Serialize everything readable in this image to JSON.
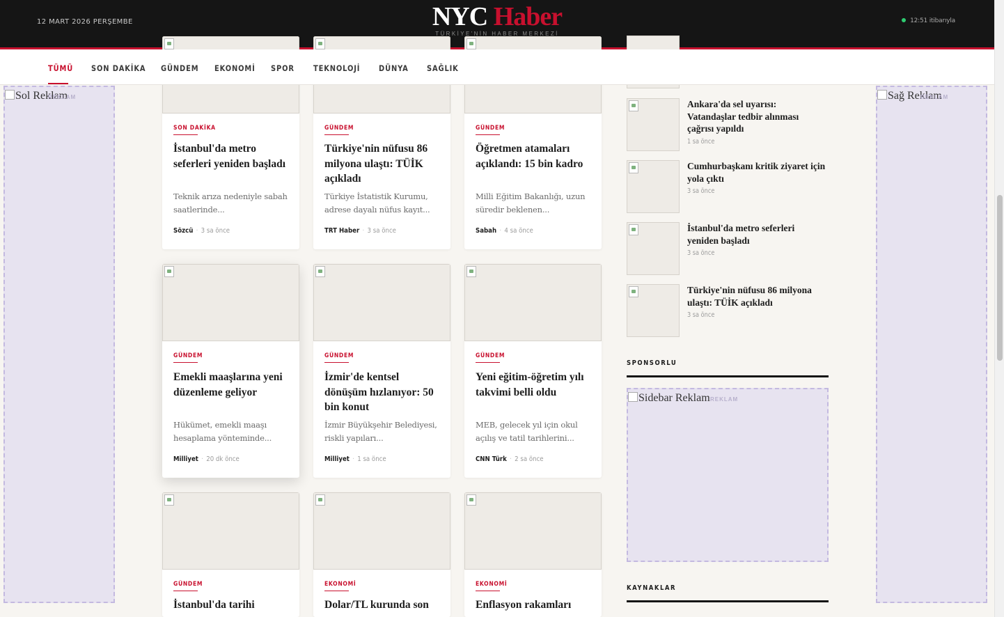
{
  "header": {
    "date": "12 MART 2026 PERŞEMBE",
    "logo_nyc": "NYC",
    "logo_haber": "Haber",
    "tagline": "TÜRKİYE'NİN HABER MERKEZİ",
    "live_time": "12:51 itibarıyla"
  },
  "nav": {
    "items": [
      "TÜMÜ",
      "SON DAKİKA",
      "GÜNDEM",
      "EKONOMİ",
      "SPOR",
      "TEKNOLOJİ",
      "DÜNYA",
      "SAĞLIK"
    ],
    "active": "TÜMÜ"
  },
  "ads": {
    "left_label": "Sol Reklam",
    "right_label": "Sağ Reklam",
    "sidebar_label": "Sidebar Reklam",
    "tag": "REKLAM"
  },
  "cards": [
    {
      "category": "SON DAKİKA",
      "title": "İstanbul'da metro seferleri yeniden başladı",
      "excerpt": "Teknik arıza nedeniyle sabah saatlerinde...",
      "source": "Sözcü",
      "time": "3 sa önce"
    },
    {
      "category": "GÜNDEM",
      "title": "Türkiye'nin nüfusu 86 milyona ulaştı: TÜİK açıkladı",
      "excerpt": "Türkiye İstatistik Kurumu, adrese dayalı nüfus kayıt...",
      "source": "TRT Haber",
      "time": "3 sa önce"
    },
    {
      "category": "GÜNDEM",
      "title": "Öğretmen atamaları açıklandı: 15 bin kadro",
      "excerpt": "Milli Eğitim Bakanlığı, uzun süredir beklenen...",
      "source": "Sabah",
      "time": "4 sa önce"
    },
    {
      "category": "GÜNDEM",
      "title": "Emekli maaşlarına yeni düzenleme geliyor",
      "excerpt": "Hükümet, emekli maaşı hesaplama yönteminde...",
      "source": "Milliyet",
      "time": "20 dk önce"
    },
    {
      "category": "GÜNDEM",
      "title": "İzmir'de kentsel dönüşüm hızlanıyor: 50 bin konut",
      "excerpt": "İzmir Büyükşehir Belediyesi, riskli yapıları...",
      "source": "Milliyet",
      "time": "1 sa önce"
    },
    {
      "category": "GÜNDEM",
      "title": "Yeni eğitim-öğretim yılı takvimi belli oldu",
      "excerpt": "MEB, gelecek yıl için okul açılış ve tatil tarihlerini...",
      "source": "CNN Türk",
      "time": "2 sa önce"
    },
    {
      "category": "GÜNDEM",
      "title": "İstanbul'da tarihi",
      "excerpt": "",
      "source": "",
      "time": ""
    },
    {
      "category": "EKONOMİ",
      "title": "Dolar/TL kurunda son",
      "excerpt": "",
      "source": "",
      "time": ""
    },
    {
      "category": "EKONOMİ",
      "title": "Enflasyon rakamları",
      "excerpt": "",
      "source": "",
      "time": ""
    }
  ],
  "sidebar": {
    "items": [
      {
        "title": "Ankara'da sel uyarısı: Vatandaşlar tedbir alınması çağrısı yapıldı",
        "time": "1 sa önce"
      },
      {
        "title": "Cumhurbaşkanı kritik ziyaret için yola çıktı",
        "time": "3 sa önce"
      },
      {
        "title": "İstanbul'da metro seferleri yeniden başladı",
        "time": "3 sa önce"
      },
      {
        "title": "Türkiye'nin nüfusu 86 milyona ulaştı: TÜİK açıkladı",
        "time": "3 sa önce"
      }
    ],
    "sponsored_heading": "SPONSORLU",
    "sources_heading": "KAYNAKLAR"
  }
}
